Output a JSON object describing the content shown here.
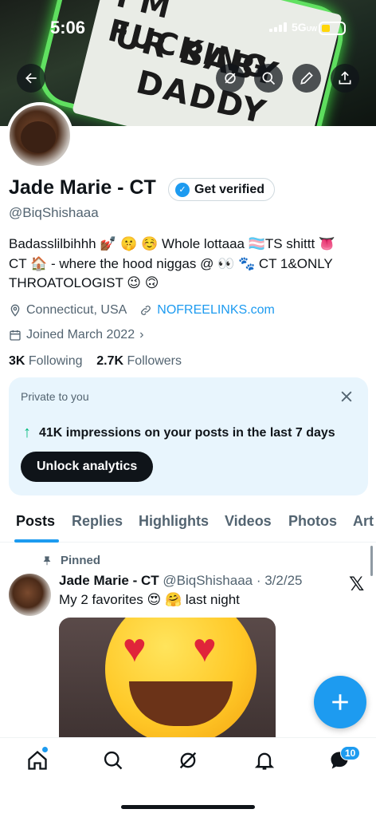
{
  "status_bar": {
    "time": "5:06",
    "network": "5G",
    "network_sub": "UW"
  },
  "header": {
    "banner_text": [
      "I'M FUCKING",
      "UR BABY",
      "DADDY"
    ]
  },
  "profile": {
    "name": "Jade Marie - CT",
    "verify_label": "Get verified",
    "handle": "@BiqShishaaa",
    "bio_line1": "Badasslilbihhh 💅🏾 🤫 ☺️ Whole lottaaa 🏳️‍⚧️TS shittt 👅",
    "bio_line2": "CT 🏠 - where the hood niggas @ 👀 🐾 CT 1&ONLY",
    "bio_line3": "THROATOLOGIST 😉 🙃",
    "location": "Connecticut, USA",
    "website": "NOFREELINKS.com",
    "joined": "Joined March 2022",
    "following_count": "3K",
    "following_label": "Following",
    "followers_count": "2.7K",
    "followers_label": "Followers"
  },
  "analytics_card": {
    "title": "Private to you",
    "impressions": "41K impressions on your posts in the last 7 days",
    "button": "Unlock analytics"
  },
  "tabs": [
    "Posts",
    "Replies",
    "Highlights",
    "Videos",
    "Photos",
    "Art"
  ],
  "post": {
    "pinned_label": "Pinned",
    "author": "Jade Marie - CT",
    "handle_date": "@BiqShishaaa · 3/2/25",
    "text": "My 2 favorites 😍 🤗 last night"
  },
  "bottom_nav": {
    "messages_badge": "10"
  },
  "colors": {
    "accent": "#1d9bf0",
    "text": "#0f1419",
    "muted": "#536471",
    "card_bg": "#e8f5fd",
    "green": "#00ba7c"
  },
  "icons": [
    "back-arrow-icon",
    "grok-icon",
    "search-icon",
    "edit-icon",
    "share-icon",
    "location-icon",
    "link-icon",
    "calendar-icon",
    "close-icon",
    "pin-icon",
    "x-logo-icon",
    "compose-plus-icon",
    "home-icon",
    "explore-icon",
    "grok-icon",
    "notifications-icon",
    "messages-icon"
  ]
}
